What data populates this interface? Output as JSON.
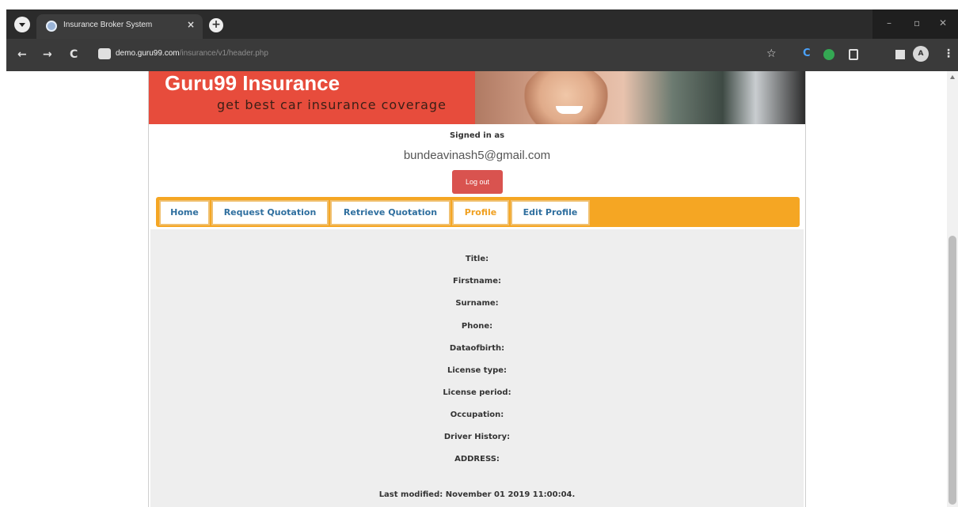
{
  "browser": {
    "tab_title": "Insurance Broker System",
    "close_glyph": "×",
    "newtab_glyph": "+",
    "url_host": "demo.guru99.com",
    "url_path": "/insurance/v1/header.php",
    "avatar_letter": "A",
    "icons": {
      "back": "←",
      "forward": "→",
      "reload": "C",
      "star": "☆",
      "menu": "⋮"
    }
  },
  "header": {
    "brand": "Guru99 Insurance",
    "tagline": "get best car insurance coverage",
    "signed_in_label": "Signed in as",
    "email": "bundeavinash5@gmail.com",
    "logout_label": "Log out"
  },
  "nav": {
    "tabs": [
      {
        "label": "Home"
      },
      {
        "label": "Request Quotation"
      },
      {
        "label": "Retrieve Quotation"
      },
      {
        "label": "Profile",
        "active": true
      },
      {
        "label": "Edit Profile"
      }
    ]
  },
  "profile": {
    "fields": [
      "Title:",
      "Firstname:",
      "Surname:",
      "Phone:",
      "Dataofbirth:",
      "License type:",
      "License period:",
      "Occupation:",
      "Driver History:",
      "ADDRESS:"
    ],
    "last_modified": "Last modified: November 01 2019 11:00:04."
  },
  "colors": {
    "banner": "#e74c3c",
    "navbar": "#f5a623",
    "logout": "#d9534f",
    "link": "#2f6f9f"
  }
}
